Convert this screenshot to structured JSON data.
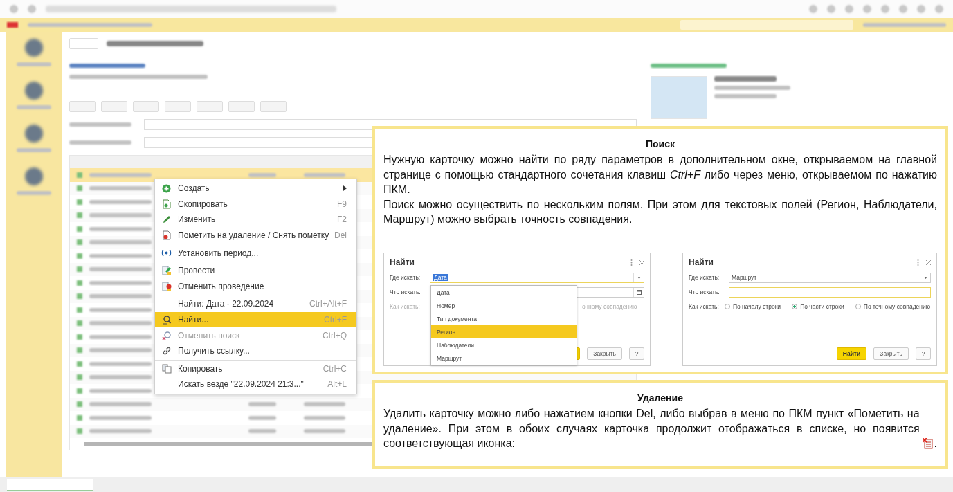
{
  "context_menu": {
    "items": [
      {
        "kind": "item",
        "label": "Создать",
        "submenu": true,
        "selected": false,
        "disabled": false
      },
      {
        "kind": "item",
        "label": "Скопировать",
        "shortcut": "F9",
        "selected": false,
        "disabled": false
      },
      {
        "kind": "item",
        "label": "Изменить",
        "shortcut": "F2",
        "selected": false,
        "disabled": false
      },
      {
        "kind": "item",
        "label": "Пометить на удаление / Снять пометку",
        "shortcut": "Del",
        "selected": false,
        "disabled": false
      },
      {
        "kind": "separator"
      },
      {
        "kind": "item",
        "label": "Установить период...",
        "selected": false,
        "disabled": false
      },
      {
        "kind": "separator"
      },
      {
        "kind": "item",
        "label": "Провести",
        "selected": false,
        "disabled": false
      },
      {
        "kind": "item",
        "label": "Отменить проведение",
        "selected": false,
        "disabled": false
      },
      {
        "kind": "separator"
      },
      {
        "kind": "item",
        "label": "Найти: Дата - 22.09.2024",
        "shortcut": "Ctrl+Alt+F",
        "selected": false,
        "disabled": false
      },
      {
        "kind": "item",
        "label": "Найти...",
        "shortcut": "Ctrl+F",
        "selected": true,
        "disabled": false
      },
      {
        "kind": "item",
        "label": "Отменить поиск",
        "shortcut": "Ctrl+Q",
        "selected": false,
        "disabled": true
      },
      {
        "kind": "item",
        "label": "Получить ссылку...",
        "selected": false,
        "disabled": false
      },
      {
        "kind": "separator"
      },
      {
        "kind": "item",
        "label": "Копировать",
        "shortcut": "Ctrl+C",
        "selected": false,
        "disabled": false
      },
      {
        "kind": "item",
        "label": "Искать везде \"22.09.2024 21:3...\"",
        "shortcut": "Alt+L",
        "selected": false,
        "disabled": false
      }
    ]
  },
  "search_note": {
    "title": "Поиск",
    "paragraphs": [
      "Нужную карточку можно найти по ряду параметров в дополнительном окне, открываемом на главной странице с помощью стандартного сочетания клавиш *Ctrl+F* либо через меню, открываемом по нажатию ПКМ.",
      "Поиск можно осуществить по нескольким полям. При этом для текстовых полей (Регион, Наблюдатели, Маршрут) можно выбрать точность совпадения."
    ],
    "dialogs": [
      {
        "title": "Найти",
        "fields": [
          {
            "label": "Где искать:",
            "kind": "dropdown",
            "value": "Дата",
            "value_selected": true,
            "focused": true
          },
          {
            "label": "Что искать:",
            "kind": "date",
            "focused": false
          }
        ],
        "how": {
          "label": "Как искать:",
          "disabled": true,
          "visible_text": "очному совпадению"
        },
        "dropdown": {
          "items": [
            {
              "label": "Дата",
              "selected": false
            },
            {
              "label": "Номер",
              "selected": false
            },
            {
              "label": "Тип документа",
              "selected": false
            },
            {
              "label": "Регион",
              "selected": true
            },
            {
              "label": "Наблюдатели",
              "selected": false
            },
            {
              "label": "Маршрут",
              "selected": false
            }
          ]
        },
        "buttons": [
          {
            "kind": "primary"
          },
          {
            "kind": "default",
            "label": "Закрыть"
          },
          {
            "kind": "default",
            "label": "?"
          }
        ]
      },
      {
        "title": "Найти",
        "fields": [
          {
            "label": "Где искать:",
            "kind": "dropdown",
            "value": "Маршрут",
            "value_selected": false,
            "focused": false
          },
          {
            "label": "Что искать:",
            "kind": "text",
            "focused": true
          }
        ],
        "how": {
          "label": "Как искать:",
          "disabled": false,
          "options": [
            {
              "label": "По началу строки",
              "selected": false
            },
            {
              "label": "По части строки",
              "selected": true
            },
            {
              "label": "По точному совпадению",
              "selected": false
            }
          ]
        },
        "buttons": [
          {
            "kind": "primary",
            "label": "Найти"
          },
          {
            "kind": "default",
            "label": "Закрыть"
          },
          {
            "kind": "default",
            "label": "?"
          }
        ]
      }
    ]
  },
  "delete_note": {
    "title": "Удаление",
    "text": "Удалить карточку можно либо нажатием кнопки Del, либо выбрав в меню по ПКМ пункт «Пометить на удаление». При этом в обоих случаях карточка продолжит отображаться в списке, но появится соответствующая иконка:",
    "text_after_icon": "."
  }
}
